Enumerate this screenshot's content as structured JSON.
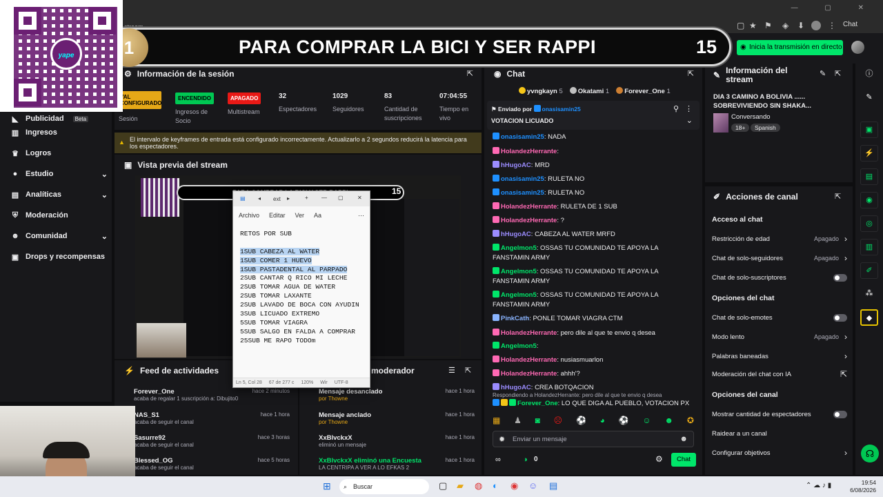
{
  "browser": {
    "chat_label": "Chat",
    "tab_hint": "stream"
  },
  "banner": {
    "number": "1",
    "title": "PARA COMPRAR LA BICI Y SER RAPPI",
    "count": "15"
  },
  "header": {
    "live_button": "Inicia la transmisión en directo"
  },
  "qr": {
    "logo_text": "yape"
  },
  "leftnav": {
    "items": [
      {
        "label": "Publicidad",
        "badge": "Beta",
        "icon": "megaphone-icon"
      },
      {
        "label": "Ingresos",
        "icon": "chart-icon"
      },
      {
        "label": "Logros",
        "icon": "trophy-icon"
      },
      {
        "label": "Estudio",
        "icon": "studio-icon"
      },
      {
        "label": "Analíticas",
        "icon": "analytics-icon"
      },
      {
        "label": "Moderación",
        "icon": "shield-icon"
      },
      {
        "label": "Comunidad",
        "icon": "people-icon"
      },
      {
        "label": "Drops y recompensas",
        "icon": "gift-icon"
      }
    ]
  },
  "session": {
    "title": "Información de la sesión",
    "config_badge": "VAL CONFIGURADO",
    "config_label": "Sesión",
    "stats": [
      {
        "badge": "ENCENDIDO",
        "label": "Ingresos de Socio"
      },
      {
        "badge": "APAGADO",
        "label": "Multistream"
      },
      {
        "value": "32",
        "label": "Espectadores"
      },
      {
        "value": "1029",
        "label": "Seguidores"
      },
      {
        "value": "83",
        "label": "Cantidad de suscripciones"
      },
      {
        "value": "07:04:55",
        "label": "Tiempo en vivo"
      }
    ],
    "warning": "El intervalo de keyframes de entrada está configurado incorrectamente. Actualizarlo a 2 segundos reducirá la latencia para los espectadores."
  },
  "preview": {
    "title": "Vista previa del stream",
    "mini_title": "PARA COMPRAR LA BICI Y SER RAPPI",
    "mini_count": "15"
  },
  "notepad": {
    "tab": "ext",
    "menu": [
      "Archivo",
      "Editar",
      "Ver"
    ],
    "lines": [
      {
        "text": "RETOS POR SUB",
        "sel": false
      },
      {
        "text": "",
        "sel": false
      },
      {
        "text": "1SUB CABEZA AL WATER",
        "sel": true
      },
      {
        "text": "1SUB COMER 1 HUEVO",
        "sel": true
      },
      {
        "text": "1SUB PASTADENTAL AL PARPADO",
        "sel": true
      },
      {
        "text": "2SUB CANTAR Q RICO MI LECHE",
        "sel": false
      },
      {
        "text": "2SUB TOMAR AGUA DE WATER",
        "sel": false
      },
      {
        "text": "2SUB TOMAR LAXANTE",
        "sel": false
      },
      {
        "text": "2SUB LAVADO DE BOCA CON AYUDIN",
        "sel": false
      },
      {
        "text": "3SUB LICUADO EXTREMO",
        "sel": false
      },
      {
        "text": "5SUB TOMAR VIAGRA",
        "sel": false
      },
      {
        "text": "5SUB SALGO EN FALDA A COMPRAR",
        "sel": false
      },
      {
        "text": "25SUB ME RAPO TODOm",
        "sel": false
      }
    ],
    "status": [
      "Ln 5, Col 28",
      "67 de 277 c",
      "120%",
      "Wir",
      "UTF-8"
    ]
  },
  "feed": {
    "title": "Feed de actividades",
    "items": [
      {
        "name": "Forever_One",
        "sub": "acaba de regalar 1 suscripción a: Dibujito0",
        "time": "hace 2 minutos"
      },
      {
        "name": "NAS_S1",
        "sub": "acaba de seguir el canal",
        "time": "hace 1 hora"
      },
      {
        "name": "Sasurre92",
        "sub": "acaba de seguir el canal",
        "time": "hace 3 horas"
      },
      {
        "name": "Blessed_OG",
        "sub": "acaba de seguir el canal",
        "time": "hace 5 horas"
      }
    ]
  },
  "modfeed": {
    "title": "moderador",
    "items": [
      {
        "name": "Mensaje desanclado",
        "sub": "por Thowne",
        "time": "hace 1 hora"
      },
      {
        "name": "Mensaje anclado",
        "sub": "por Thowne",
        "time": "hace 1 hora"
      },
      {
        "name": "XxBlvckxX",
        "sub": "eliminó un mensaje",
        "time": "hace 1 hora"
      },
      {
        "name": "XxBlvckxX eliminó una Encuesta",
        "sub": "LA CENTRIPA A VER A LO EFKAS 2",
        "time": "hace 1 hora"
      }
    ]
  },
  "chat": {
    "title": "Chat",
    "top": [
      {
        "name": "yvngkayn",
        "n": "5"
      },
      {
        "name": "Okatami",
        "n": "1"
      },
      {
        "name": "Forever_One",
        "n": "1"
      }
    ],
    "pinned_by_label": "Enviado por",
    "pinned_by": "onasisamin25",
    "pinned_text": "VOTACION LICUADO",
    "messages": [
      {
        "user": "onasisamin25",
        "text": ": NADA",
        "color": "#1e90ff"
      },
      {
        "user": "HolandezHerrante",
        "text": ":",
        "color": "#ff69b4"
      },
      {
        "user": "hHugoAC",
        "text": ": MRD",
        "color": "#9b8cff"
      },
      {
        "user": "onasisamin25",
        "text": ": RULETA NO",
        "color": "#1e90ff"
      },
      {
        "user": "onasisamin25",
        "text": ": RULETA NO",
        "color": "#1e90ff"
      },
      {
        "user": "HolandezHerrante",
        "text": ": RULETA DE 1 SUB",
        "color": "#ff69b4"
      },
      {
        "user": "HolandezHerrante",
        "text": ": ?",
        "color": "#ff69b4"
      },
      {
        "user": "hHugoAC",
        "text": ": CABEZA AL WATER MRFD",
        "color": "#9b8cff"
      },
      {
        "user": "Angelmon5",
        "text": ": OSSAS TU COMUNIDAD TE APOYA LA FANSTAMIN ARMY",
        "color": "#00e66a"
      },
      {
        "user": "Angelmon5",
        "text": ": OSSAS TU COMUNIDAD TE APOYA LA FANSTAMIN ARMY",
        "color": "#00e66a"
      },
      {
        "user": "Angelmon5",
        "text": ": OSSAS TU COMUNIDAD TE APOYA LA FANSTAMIN ARMY",
        "color": "#00e66a"
      },
      {
        "user": "PinkCath",
        "text": ": PONLE TOMAR VIAGRA CTM",
        "color": "#8ab4ff"
      },
      {
        "user": "HolandezHerrante",
        "text": ": pero dile al que te envio q desea",
        "color": "#ff69b4"
      },
      {
        "user": "Angelmon5",
        "text": ":",
        "color": "#00e66a"
      },
      {
        "user": "HolandezHerrante",
        "text": ": nusiasmuarlon",
        "color": "#ff69b4"
      },
      {
        "user": "HolandezHerrante",
        "text": ": ahhh'?",
        "color": "#ff69b4"
      },
      {
        "user": "hHugoAC",
        "text": ": CREA BOTQACION",
        "color": "#9b8cff"
      }
    ],
    "reply_hint": "Respondiendo a HolandezHerrante: pero dile al que te envio q desea",
    "reply": {
      "user": "Forever_One",
      "text": ": LO QUE DIGA AL PUEBLO, VOTACION PX",
      "color": "#00e66a"
    },
    "input_placeholder": "Enviar un mensaje",
    "points": "0",
    "send_label": "Chat"
  },
  "info": {
    "title": "Información del stream",
    "stream_title": "DIA 3 CAMINO A BOLIVIA ...... SOBREVIVIENDO SIN SHAKA...",
    "category": "Conversando",
    "tags": [
      "18+",
      "Spanish"
    ]
  },
  "actions": {
    "title": "Acciones de canal",
    "sections": [
      {
        "head": "Acceso al chat"
      },
      {
        "label": "Restricción de edad",
        "value": "Apagado",
        "kind": "chev"
      },
      {
        "label": "Chat de solo-seguidores",
        "value": "Apagado",
        "kind": "chev"
      },
      {
        "label": "Chat de solo-suscriptores",
        "kind": "toggle"
      },
      {
        "head": "Opciones del chat"
      },
      {
        "label": "Chat de solo-emotes",
        "kind": "toggle"
      },
      {
        "label": "Modo lento",
        "value": "Apagado",
        "kind": "chev"
      },
      {
        "label": "Palabras baneadas",
        "kind": "chev"
      },
      {
        "label": "Moderación del chat con IA",
        "kind": "ext"
      },
      {
        "head": "Opciones del canal"
      },
      {
        "label": "Mostrar cantidad de espectadores",
        "kind": "toggle"
      },
      {
        "label": "Raidear a un canal",
        "kind": "none"
      },
      {
        "label": "Configurar objetivos",
        "kind": "chev"
      }
    ]
  },
  "taskbar": {
    "search": "Buscar",
    "time": "19:54",
    "date": "6/08/2026"
  }
}
